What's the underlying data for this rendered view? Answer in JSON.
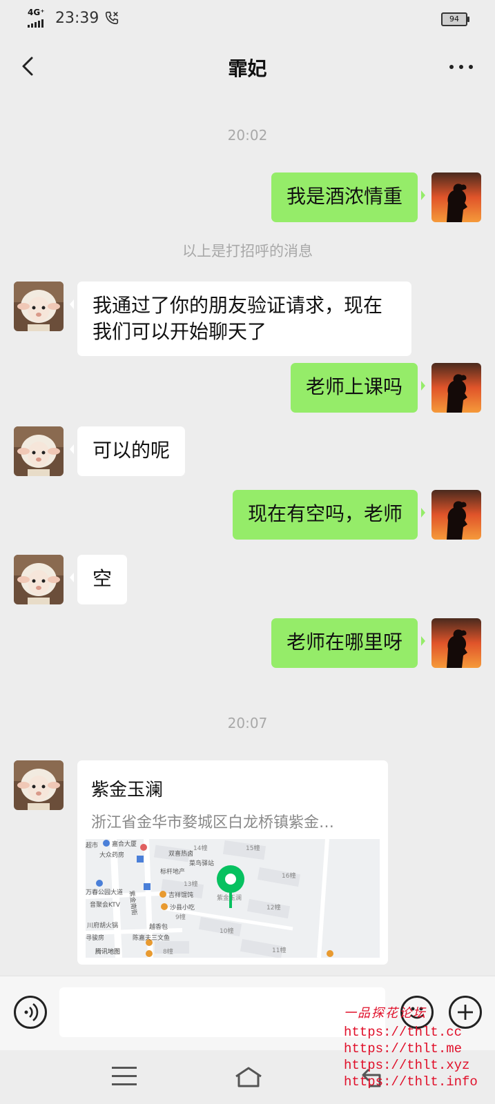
{
  "status_bar": {
    "network": "4G⁺",
    "time": "23:39",
    "battery": "94",
    "call_icon": "phone-forward-icon"
  },
  "nav": {
    "title": "霏妃",
    "back_icon": "chevron-left-icon",
    "more_icon": "more-dots-icon"
  },
  "chat": {
    "timestamp_1": "20:02",
    "msg_1": "我是酒浓情重",
    "system_notice": "以上是打招呼的消息",
    "msg_2": "我通过了你的朋友验证请求，现在我们可以开始聊天了",
    "msg_3": "老师上课吗",
    "msg_4": "可以的呢",
    "msg_5": "现在有空吗，老师",
    "msg_6": "空",
    "msg_7": "老师在哪里呀",
    "timestamp_2": "20:07",
    "location": {
      "name": "紫金玉澜",
      "address": "浙江省金华市婺城区白龙桥镇紫金…",
      "map_labels": [
        "超市",
        "嘉合大厦",
        "大众药房",
        "14幢",
        "15幢",
        "双喜热卤",
        "菜鸟驿站",
        "标杆地产",
        "16幢",
        "13幢",
        "万春公园大道",
        "吉祥馄饨",
        "紫金玉澜",
        "音聚会KTV",
        "沙县小吃",
        "12幢",
        "9幢",
        "川府胡火锅",
        "越香包",
        "10幢",
        "寻骏房",
        "陈嘉夫三文鱼",
        "8幢",
        "11幢",
        "紫金南街"
      ],
      "map_provider": "腾讯地图"
    }
  },
  "input_bar": {
    "voice_icon": "voice-icon",
    "input_value": "",
    "emoji_icon": "emoji-icon",
    "plus_icon": "plus-icon"
  },
  "system_nav": {
    "menu_icon": "menu-icon",
    "home_icon": "home-icon",
    "back_icon": "back-icon"
  },
  "watermark": {
    "title": "一品探花论坛",
    "urls": [
      "https://thlt.cc",
      "https://thlt.me",
      "https://thlt.xyz",
      "https://thlt.info"
    ]
  },
  "colors": {
    "sent_bubble": "#95ec69",
    "received_bubble": "#ffffff",
    "background": "#ededed",
    "map_pin": "#07c160",
    "watermark": "#e0102a"
  }
}
